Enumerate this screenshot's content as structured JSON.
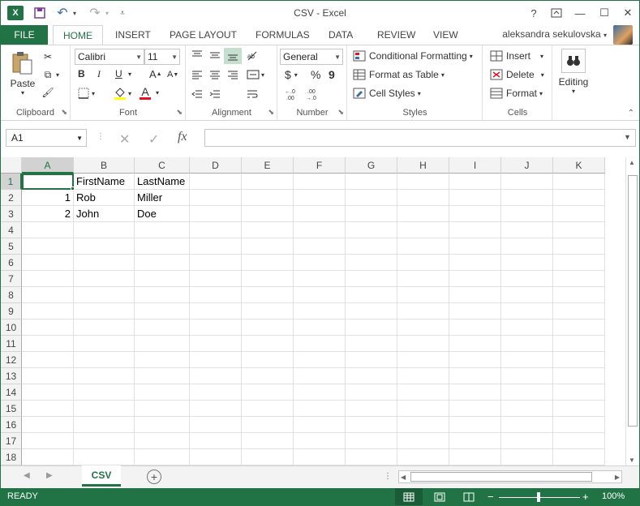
{
  "window": {
    "title": "CSV - Excel",
    "help": "?",
    "minimize": "—",
    "restore": "☐",
    "close": "✕"
  },
  "qat": {
    "excel_logo": "X",
    "save": "💾",
    "undo": "↶",
    "redo": "↷",
    "customize": "⌄"
  },
  "tabs": {
    "file": "FILE",
    "items": [
      "HOME",
      "INSERT",
      "PAGE LAYOUT",
      "FORMULAS",
      "DATA",
      "REVIEW",
      "VIEW"
    ]
  },
  "user": {
    "name": "aleksandra sekulovska"
  },
  "ribbon": {
    "clipboard": {
      "label": "Clipboard",
      "paste": "Paste"
    },
    "font": {
      "label": "Font",
      "family": "Calibri",
      "size": "11",
      "bold": "B",
      "italic": "I",
      "underline": "U",
      "grow": "A",
      "shrink": "A",
      "color_letter": "A"
    },
    "alignment": {
      "label": "Alignment"
    },
    "number": {
      "label": "Number",
      "format": "General",
      "currency": "$",
      "percent": "%",
      "comma": "9"
    },
    "styles": {
      "label": "Styles",
      "conditional": "Conditional Formatting",
      "table": "Format as Table",
      "cell_styles": "Cell Styles"
    },
    "cells": {
      "label": "Cells",
      "insert": "Insert",
      "delete": "Delete",
      "format": "Format"
    },
    "editing": {
      "label": "Editing"
    }
  },
  "formula_bar": {
    "name_box": "A1",
    "fx": "fx",
    "formula": ""
  },
  "columns": [
    "A",
    "B",
    "C",
    "D",
    "E",
    "F",
    "G",
    "H",
    "I",
    "J",
    "K"
  ],
  "rows": [
    "1",
    "2",
    "3",
    "4",
    "5",
    "6",
    "7",
    "8",
    "9",
    "10",
    "11",
    "12",
    "13",
    "14",
    "15",
    "16",
    "17",
    "18"
  ],
  "cells": {
    "B1": "FirstName",
    "C1": "LastName",
    "A2": "1",
    "B2": "Rob",
    "C2": "Miller",
    "A3": "2",
    "B3": "John",
    "C3": "Doe"
  },
  "sheets": {
    "active": "CSV",
    "add": "+"
  },
  "status": {
    "ready": "READY",
    "zoom": "100%",
    "zoom_minus": "−",
    "zoom_plus": "+"
  },
  "colors": {
    "accent": "#217346",
    "selected_header_bg": "#d2d2d2"
  }
}
